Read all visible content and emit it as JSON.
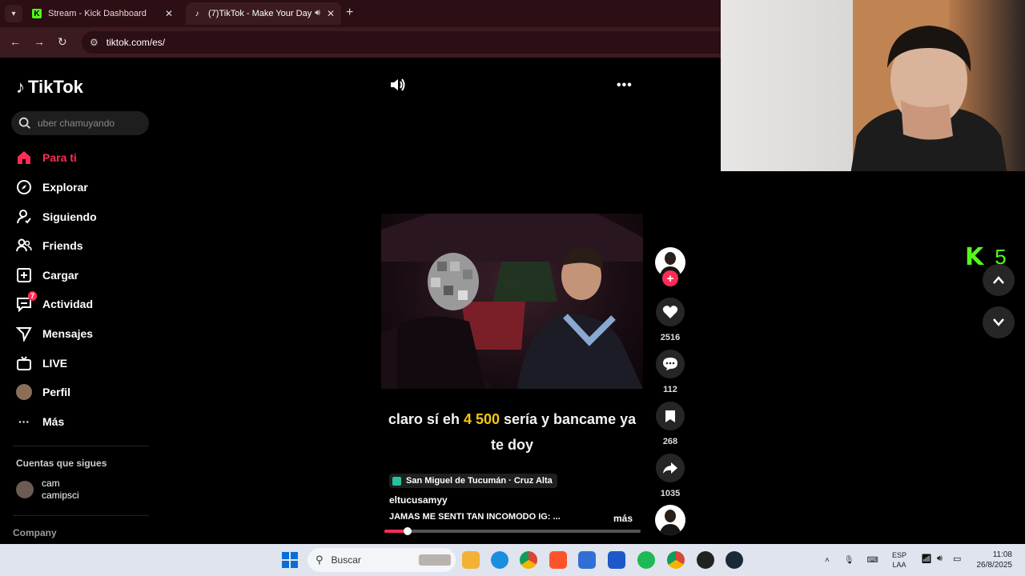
{
  "browser": {
    "tabs": [
      {
        "label": "Stream - Kick Dashboard",
        "favicon": "kick-icon"
      },
      {
        "label": "(7)TikTok - Make Your Day",
        "favicon": "tiktok-icon",
        "active": true,
        "audio": true
      }
    ],
    "url": "tiktok.com/es/"
  },
  "sidebar": {
    "logo_text": "TikTok",
    "search_placeholder": "uber chamuyando",
    "items": [
      {
        "label": "Para ti",
        "icon": "home-icon",
        "active": true
      },
      {
        "label": "Explorar",
        "icon": "compass-icon"
      },
      {
        "label": "Siguiendo",
        "icon": "user-follow-icon"
      },
      {
        "label": "Friends",
        "icon": "friends-icon"
      },
      {
        "label": "Cargar",
        "icon": "upload-icon"
      },
      {
        "label": "Actividad",
        "icon": "inbox-icon",
        "badge": "7"
      },
      {
        "label": "Mensajes",
        "icon": "send-icon"
      },
      {
        "label": "LIVE",
        "icon": "tv-icon"
      },
      {
        "label": "Perfil",
        "icon": "profile-avatar"
      },
      {
        "label": "Más",
        "icon": "more-icon"
      }
    ],
    "following_header": "Cuentas que sigues",
    "following": [
      {
        "name": "cam",
        "handle": "camipsci"
      }
    ],
    "company_label": "Company"
  },
  "video": {
    "caption_before": "claro sí eh ",
    "caption_highlight": "4 500",
    "caption_after": " sería y bancame ya te doy",
    "location": "San Miguel de Tucumán · Cruz Alta",
    "author": "eltucusamyy",
    "description": "JAMAS ME SENTI TAN INCOMODO IG: ...",
    "more_label": "más",
    "progress": 0.09
  },
  "actions": {
    "likes": "2516",
    "comments": "112",
    "saves": "268",
    "shares": "1035"
  },
  "overlay": {
    "kick_logo": "K",
    "kick_count": "5"
  },
  "taskbar": {
    "search_label": "Buscar",
    "lang_top": "ESP",
    "lang_bottom": "LAA",
    "time": "11:08",
    "date": "26/8/2025"
  },
  "colors": {
    "accent": "#fe2c55",
    "highlight": "#f5c518",
    "kick_green": "#53fc18",
    "browser_frame": "#2b0f14"
  }
}
